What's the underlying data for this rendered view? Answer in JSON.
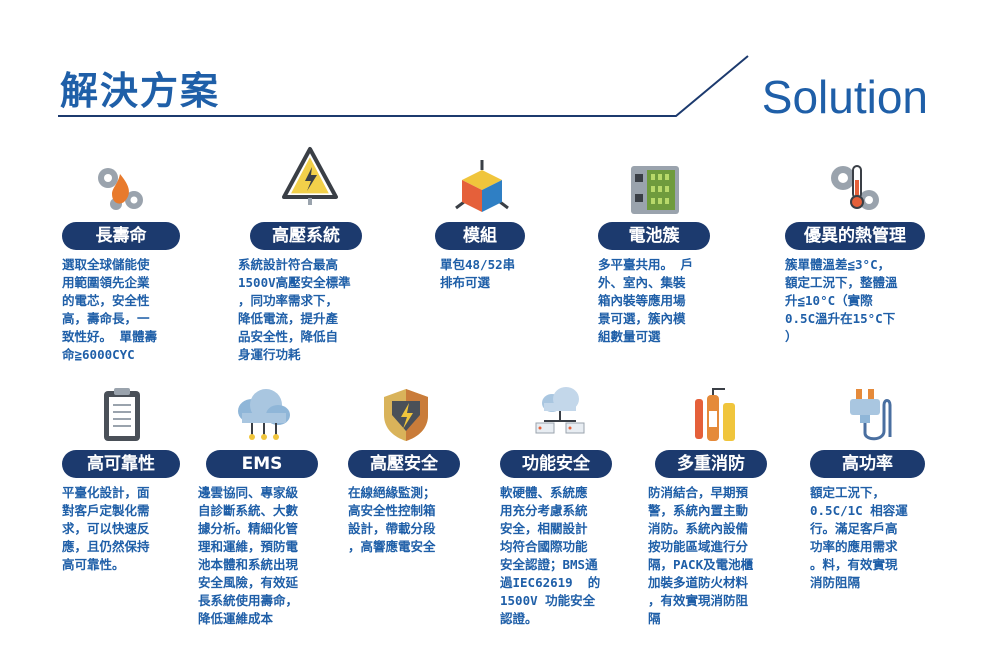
{
  "header": {
    "title_zh": "解決方案",
    "title_en": "Solution"
  },
  "row1": [
    {
      "title": "長壽命",
      "icon": "gears-flame-icon",
      "desc": "選取全球儲能使\n用範圍領先企業\n的電芯，安全性\n高，壽命長，一\n致性好。 單體壽\n命≧6000CYC"
    },
    {
      "title": "高壓系統",
      "icon": "high-voltage-warning-icon",
      "desc": "系統設計符合最高\n1500V高壓安全標準\n，同功率需求下，\n降低電流，提升產\n品安全性，降低自\n身運行功耗"
    },
    {
      "title": "模組",
      "icon": "cube-module-icon",
      "desc": "單包48/52串\n排布可選"
    },
    {
      "title": "電池簇",
      "icon": "battery-cluster-icon",
      "desc": "多平臺共用。 戶\n外、室內、集裝\n箱內裝等應用場\n景可選，簇內模\n組數量可選"
    },
    {
      "title": "優異的熱管理",
      "icon": "gears-thermometer-icon",
      "desc": "簇單體溫差≦3°C，\n額定工況下，整體溫\n升≦10°C（實際\n0.5C溫升在15°C下\n）"
    }
  ],
  "row2": [
    {
      "title": "高可靠性",
      "icon": "clipboard-icon",
      "desc": "平臺化設計，面\n對客戶定製化需\n求，可以快速反\n應，且仍然保持\n高可靠性。"
    },
    {
      "title": "EMS",
      "icon": "cloud-network-icon",
      "desc": "邊雲協同、專家級\n自診斷系統、大數\n據分析。精細化管\n理和運維，預防電\n池本體和系統出現\n安全風險，有效延\n長系統使用壽命，\n降低運維成本"
    },
    {
      "title": "高壓安全",
      "icon": "shield-bolt-icon",
      "desc": "在線絕緣監測；\n高安全性控制箱\n設計，帶載分段\n，高響應電安全"
    },
    {
      "title": "功能安全",
      "icon": "cloud-server-icon",
      "desc": "軟硬體、系統應\n用充分考慮系統\n安全，相關設計\n均符合國際功能\n安全認證；BMS通\n過IEC62619  的\n1500V 功能安全\n認證。"
    },
    {
      "title": "多重消防",
      "icon": "fire-extinguisher-icon",
      "desc": "防消結合，早期預\n警，系統內置主動\n消防。系統內設備\n按功能區域進行分\n隔，PACK及電池櫃\n加裝多道防火材料\n，有效實現消防阻\n隔"
    },
    {
      "title": "高功率",
      "icon": "power-plug-icon",
      "desc": "額定工況下，\n0.5C/1C 相容運\n行。滿足客戶高\n功率的應用需求\n。料，有效實現\n消防阻隔"
    }
  ]
}
